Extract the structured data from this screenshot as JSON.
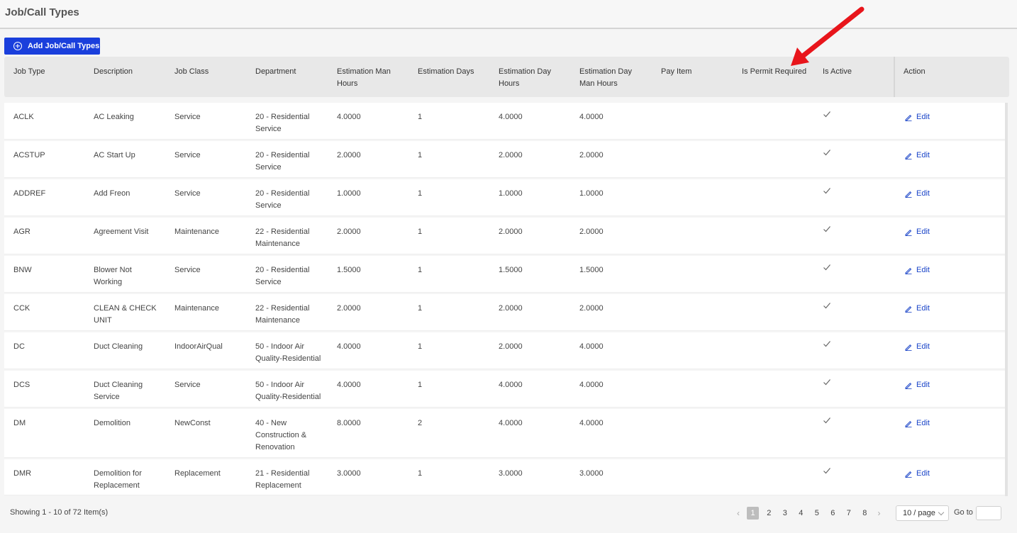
{
  "page": {
    "title": "Job/Call Types"
  },
  "toolbar": {
    "add_label": "Add Job/Call Types"
  },
  "table": {
    "columns": [
      {
        "key": "job_type",
        "label": "Job Type"
      },
      {
        "key": "description",
        "label": "Description"
      },
      {
        "key": "job_class",
        "label": "Job Class"
      },
      {
        "key": "department",
        "label": "Department"
      },
      {
        "key": "est_man_hours",
        "label": "Estimation Man\nHours"
      },
      {
        "key": "est_days",
        "label": "Estimation Days"
      },
      {
        "key": "est_day_hours",
        "label": "Estimation Day\nHours"
      },
      {
        "key": "est_day_man_hours",
        "label": "Estimation Day\nMan Hours"
      },
      {
        "key": "pay_item",
        "label": "Pay Item"
      },
      {
        "key": "is_permit_required",
        "label": "Is Permit Required"
      },
      {
        "key": "is_active",
        "label": "Is Active"
      },
      {
        "key": "action",
        "label": "Action"
      }
    ],
    "edit_label": "Edit",
    "rows": [
      {
        "job_type": "ACLK",
        "description": "AC Leaking",
        "job_class": "Service",
        "department": "20 - Residential\nService",
        "est_man_hours": "4.0000",
        "est_days": "1",
        "est_day_hours": "4.0000",
        "est_day_man_hours": "4.0000",
        "pay_item": "",
        "is_permit_required": "",
        "is_active": true
      },
      {
        "job_type": "ACSTUP",
        "description": "AC Start Up",
        "job_class": "Service",
        "department": "20 - Residential\nService",
        "est_man_hours": "2.0000",
        "est_days": "1",
        "est_day_hours": "2.0000",
        "est_day_man_hours": "2.0000",
        "pay_item": "",
        "is_permit_required": "",
        "is_active": true
      },
      {
        "job_type": "ADDREF",
        "description": "Add Freon",
        "job_class": "Service",
        "department": "20 - Residential\nService",
        "est_man_hours": "1.0000",
        "est_days": "1",
        "est_day_hours": "1.0000",
        "est_day_man_hours": "1.0000",
        "pay_item": "",
        "is_permit_required": "",
        "is_active": true
      },
      {
        "job_type": "AGR",
        "description": "Agreement Visit",
        "job_class": "Maintenance",
        "department": "22 - Residential\nMaintenance",
        "est_man_hours": "2.0000",
        "est_days": "1",
        "est_day_hours": "2.0000",
        "est_day_man_hours": "2.0000",
        "pay_item": "",
        "is_permit_required": "",
        "is_active": true
      },
      {
        "job_type": "BNW",
        "description": "Blower Not\nWorking",
        "job_class": "Service",
        "department": "20 - Residential\nService",
        "est_man_hours": "1.5000",
        "est_days": "1",
        "est_day_hours": "1.5000",
        "est_day_man_hours": "1.5000",
        "pay_item": "",
        "is_permit_required": "",
        "is_active": true
      },
      {
        "job_type": "CCK",
        "description": "CLEAN & CHECK\nUNIT",
        "job_class": "Maintenance",
        "department": "22 - Residential\nMaintenance",
        "est_man_hours": "2.0000",
        "est_days": "1",
        "est_day_hours": "2.0000",
        "est_day_man_hours": "2.0000",
        "pay_item": "",
        "is_permit_required": "",
        "is_active": true
      },
      {
        "job_type": "DC",
        "description": "Duct Cleaning",
        "job_class": "IndoorAirQual",
        "department": "50 - Indoor Air\nQuality-Residential",
        "est_man_hours": "4.0000",
        "est_days": "1",
        "est_day_hours": "2.0000",
        "est_day_man_hours": "4.0000",
        "pay_item": "",
        "is_permit_required": "",
        "is_active": true
      },
      {
        "job_type": "DCS",
        "description": "Duct Cleaning\nService",
        "job_class": "Service",
        "department": "50 - Indoor Air\nQuality-Residential",
        "est_man_hours": "4.0000",
        "est_days": "1",
        "est_day_hours": "4.0000",
        "est_day_man_hours": "4.0000",
        "pay_item": "",
        "is_permit_required": "",
        "is_active": true
      },
      {
        "job_type": "DM",
        "description": "Demolition",
        "job_class": "NewConst",
        "department": "40 - New\nConstruction &\nRenovation",
        "est_man_hours": "8.0000",
        "est_days": "2",
        "est_day_hours": "4.0000",
        "est_day_man_hours": "4.0000",
        "pay_item": "",
        "is_permit_required": "",
        "is_active": true
      },
      {
        "job_type": "DMR",
        "description": "Demolition for\nReplacement",
        "job_class": "Replacement",
        "department": "21 - Residential\nReplacement",
        "est_man_hours": "3.0000",
        "est_days": "1",
        "est_day_hours": "3.0000",
        "est_day_man_hours": "3.0000",
        "pay_item": "",
        "is_permit_required": "",
        "is_active": true
      }
    ]
  },
  "footer": {
    "showing_text": "Showing 1 - 10 of 72 Item(s)",
    "pages": [
      "1",
      "2",
      "3",
      "4",
      "5",
      "6",
      "7",
      "8"
    ],
    "current_page": "1",
    "page_size": "10 / page",
    "goto_label": "Go to",
    "goto_value": ""
  },
  "colors": {
    "primary": "#1a3fdc",
    "link": "#1a44c8",
    "annotation": "#e8151b",
    "header_bg": "#e8e8e8"
  }
}
